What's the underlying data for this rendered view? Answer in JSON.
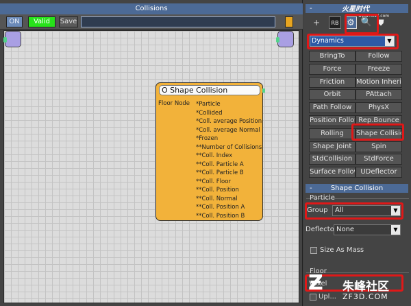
{
  "window": {
    "title": "Collisions"
  },
  "toolbar": {
    "on_label": "ON",
    "valid_label": "Valid",
    "save_label": "Save"
  },
  "node": {
    "title": "O Shape Collision",
    "input_label": "Floor Node",
    "outputs": [
      "*Particle",
      "*Collided",
      "*Coll. average Position",
      "*Coll. average Normal",
      "*Frozen",
      "**Number of Collisions",
      "**Coll. Index",
      "**Coll. Particle A",
      "**Coll. Particle B",
      "**Coll. Floor",
      "**Coll. Position",
      "**Coll. Normal",
      "**Coll. Position A",
      "**Coll. Position B"
    ]
  },
  "panel": {
    "top_rollout": {
      "minus": "-"
    },
    "logo": "火星时代",
    "logo_sub": "www.hxsd.com",
    "icons": {
      "create": "+",
      "rbox": "RB",
      "gear": "⚙",
      "search": "🔍",
      "shield": "⛊"
    },
    "category_select": "Dynamics",
    "operators": [
      [
        "BringTo",
        "Follow"
      ],
      [
        "Force",
        "Freeze"
      ],
      [
        "Friction",
        "Motion Inherit."
      ],
      [
        "Orbit",
        "PAttach"
      ],
      [
        "Path Follow",
        "PhysX"
      ],
      [
        "Position Follow",
        "Rep.Bounce"
      ],
      [
        "Rolling",
        "Shape Collision"
      ],
      [
        "Shape Joint",
        "Spin"
      ],
      [
        "StdCollision",
        "StdForce"
      ],
      [
        "Surface Follow",
        "UDeflector"
      ]
    ],
    "shape_rollout": {
      "minus": "-",
      "title": "Shape Collision"
    },
    "particle_group": {
      "title": "Particle",
      "group_label": "Group",
      "group_value": "All",
      "deflector_label": "Deflector",
      "deflector_value": "None",
      "size_as_mass": "Size As Mass"
    },
    "floor_group": {
      "title": "Floor",
      "voxel_label": "Voxel",
      "option_label": "Upl..."
    }
  },
  "watermark": {
    "text": "朱峰社区",
    "sub": "ZF3D.COM"
  }
}
